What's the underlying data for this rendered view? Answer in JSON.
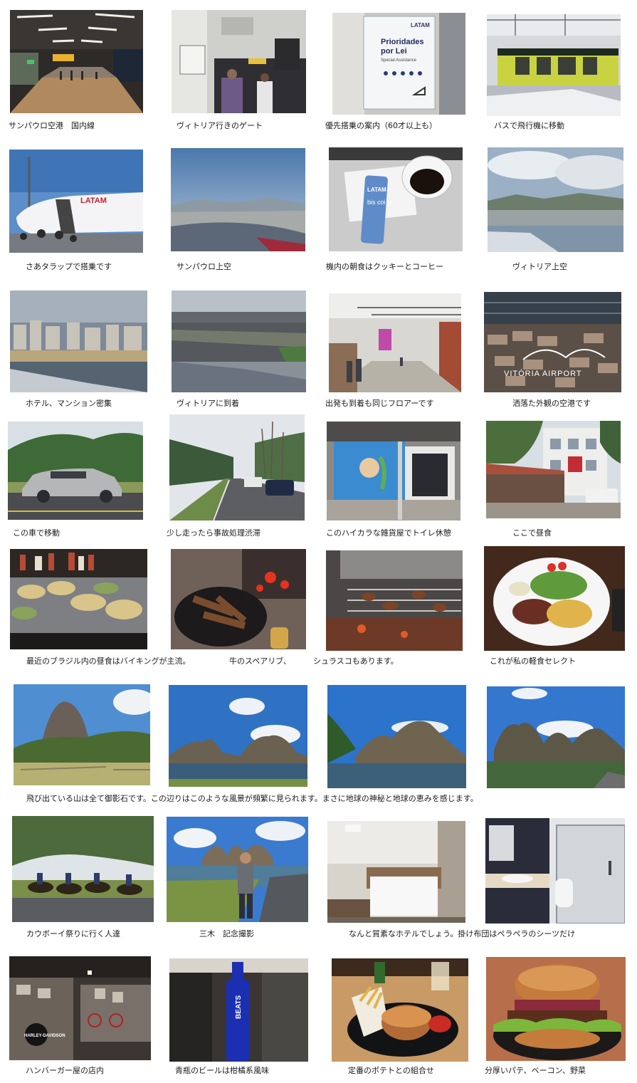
{
  "captions": {
    "r1": [
      "サンパウロ空港　国内線",
      "ヴィトリア行きのゲート",
      "優先搭乗の案内（60才以上も）",
      "バスで飛行機に移動"
    ],
    "r2": [
      "さあタラップで搭乗です",
      "サンパウロ上空",
      "機内の朝食はクッキーとコーヒー",
      "ヴィトリア上空"
    ],
    "r3": [
      "ホテル、マンション密集",
      "ヴィトリアに到着",
      "出発も到着も同じフロアーです",
      "洒落た外観の空港です"
    ],
    "r4": [
      "この車で移動",
      "少し走ったら事故処理渋滞",
      "このハイカラな雑貨屋でトイレ休憩",
      "ここで昼食"
    ],
    "r5": [
      "最近のブラジル内の昼食はバイキングが主流。",
      "牛のスペアリブ、",
      "シュラスコもあります。",
      "これが私の軽食セレクト"
    ],
    "r6": [
      "飛び出ている山は全て御影石です。この辺りはこのような風景が頻繁に見られます。まさに地球の神秘と地球の恵みを感じます。"
    ],
    "r7": [
      "カウボーイ祭りに行く人達",
      "三木　記念撮影",
      "なんと質素なホテルでしょう。掛け布団はペラペラのシーツだけ"
    ],
    "r8": [
      "ハンバーガー屋の店内",
      "青瓶のビールは柑橘系風味",
      "定番のポテトとの組合せ",
      "分厚いパテ、ベーコン、野菜"
    ]
  },
  "signs": {
    "latam": "LATAM",
    "prioridades": "Prioridades",
    "por_lei": "por Lei",
    "special": "Special Assistance",
    "biscoito": "bis coi to",
    "airport": "VITÓRIA AIRPORT",
    "beats": "BEATS",
    "harley": "HARLEY-DAVIDSON"
  }
}
